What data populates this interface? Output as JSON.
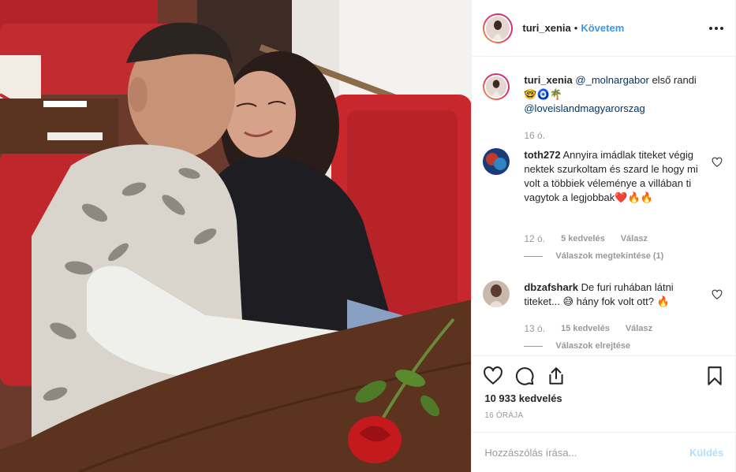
{
  "colors": {
    "link": "#3897f0",
    "mention": "#003569",
    "muted": "#999999",
    "post_disabled": "#b2dffc",
    "border": "#efefef"
  },
  "header": {
    "username": "turi_xenia",
    "separator": "•",
    "follow_label": "Követem",
    "more_icon": "more-horizontal-icon"
  },
  "caption": {
    "username": "turi_xenia",
    "mention": "@_molnargabor",
    "text": "első randi",
    "emojis": "🤓🧿🌴",
    "hashtag": "@loveislandmagyarorszag",
    "time": "16 ó."
  },
  "comments": [
    {
      "username": "toth272",
      "text": "Annyira imádlak titeket végig nektek szurkoltam és szard le hogy mi volt a többiek véleménye a villában ti vagytok a legjobbak❤️🔥🔥",
      "time": "12 ó.",
      "likes": "5 kedvelés",
      "reply_label": "Válasz",
      "replies_label": "Válaszok megtekintése (1)"
    },
    {
      "username": "dbzafshark",
      "text": "De furi ruhában látni titeket... 😅 hány fok volt ott? 🔥",
      "time": "13 ó.",
      "likes": "15 kedvelés",
      "reply_label": "Válasz",
      "replies_label": "Válaszok elrejtése"
    }
  ],
  "actions": {
    "like_icon": "heart-icon",
    "comment_icon": "comment-icon",
    "share_icon": "share-icon",
    "save_icon": "bookmark-icon"
  },
  "likes_count": "10 933 kedvelés",
  "posted_ago": "16 ÓRÁJA",
  "add_comment": {
    "placeholder": "Hozzászólás írása...",
    "post_label": "Küldés"
  }
}
